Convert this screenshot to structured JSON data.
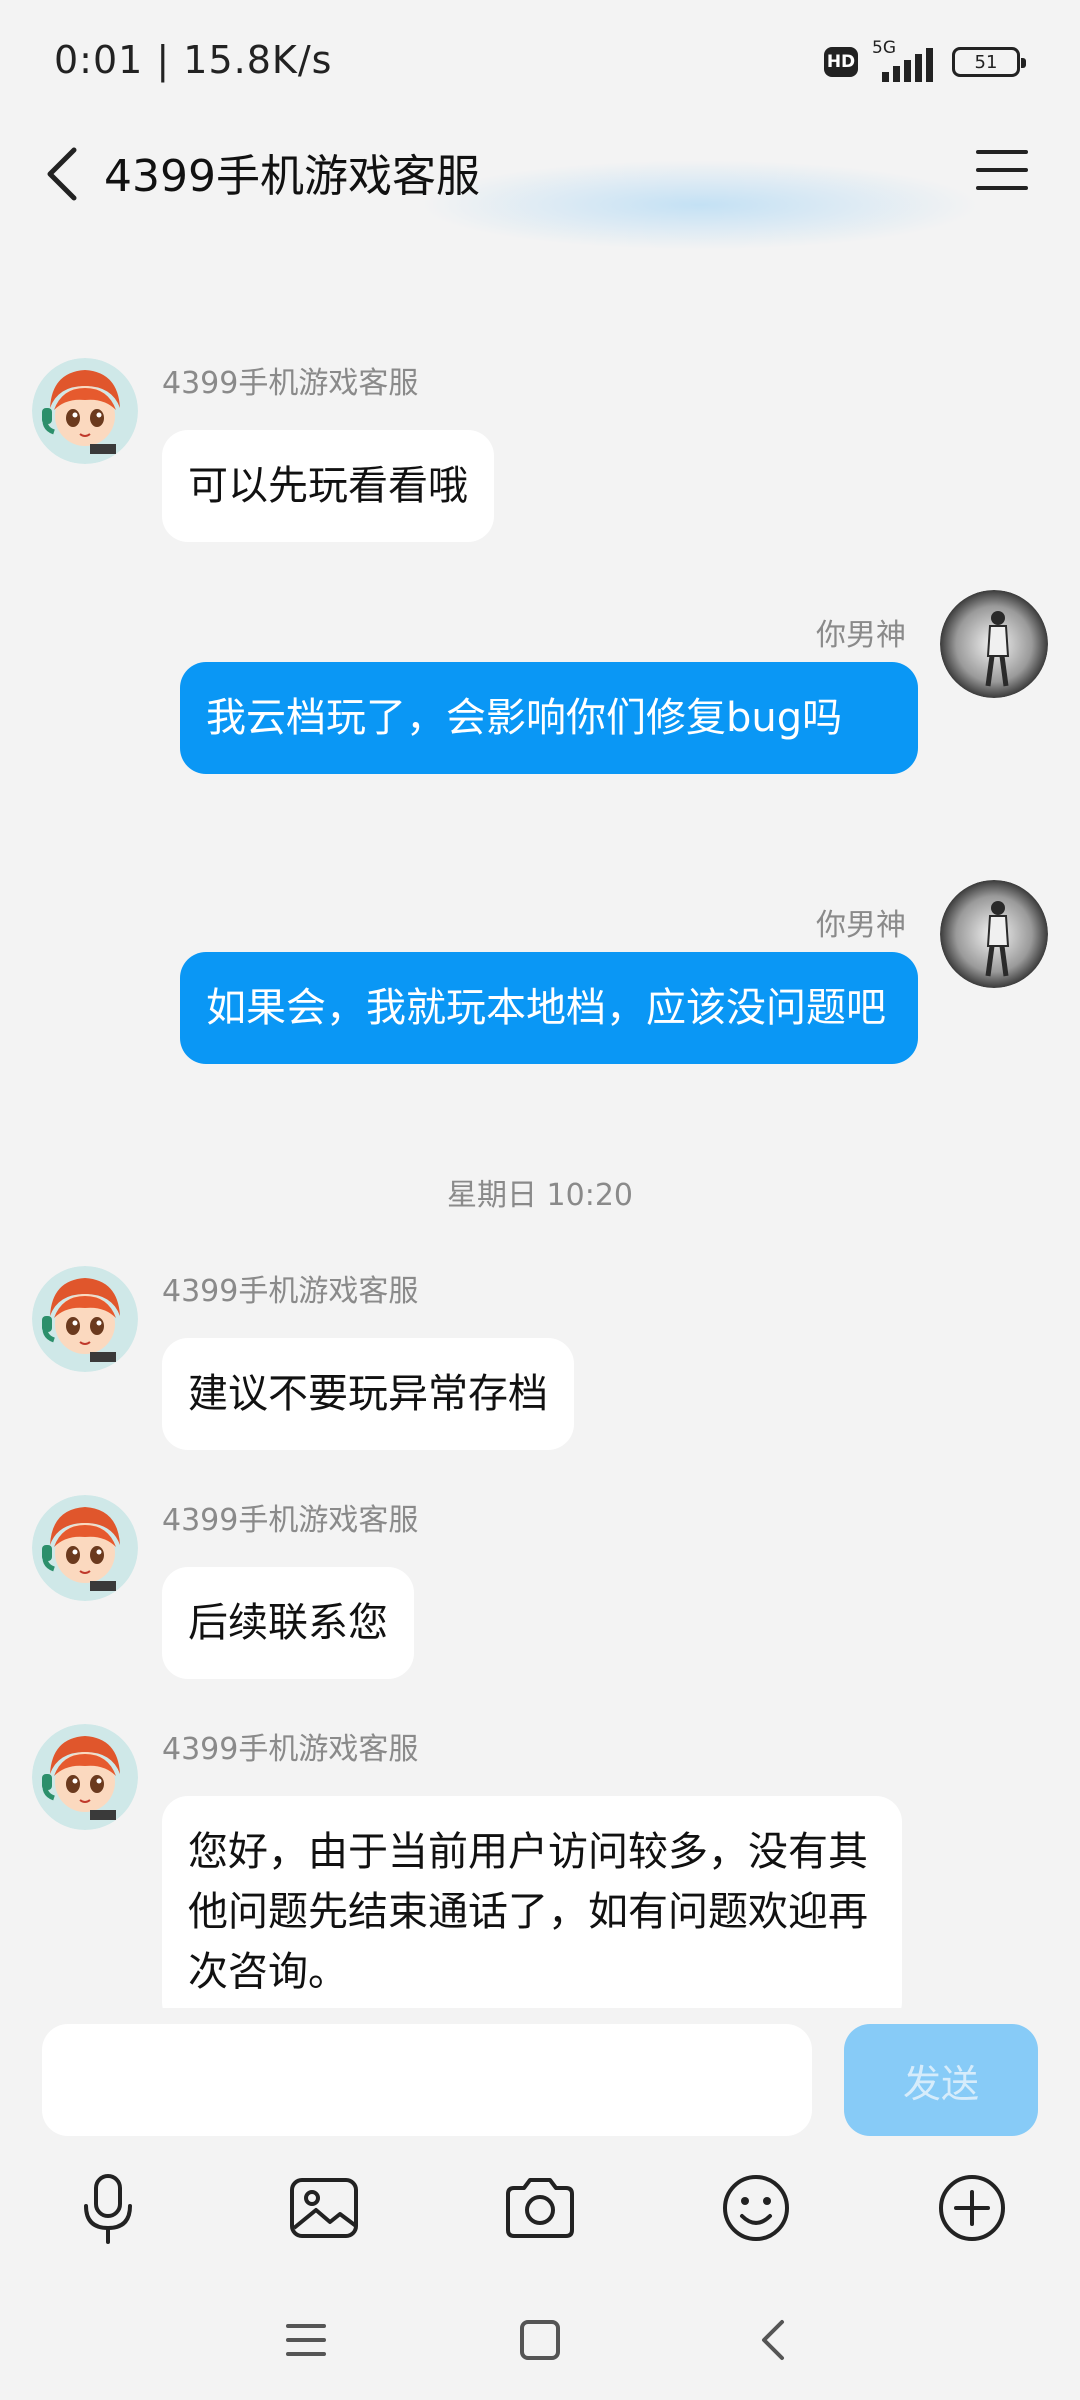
{
  "status_bar": {
    "time_speed": "0:01 | 15.8K/s",
    "hd": "HD",
    "network": "5G",
    "battery": "51"
  },
  "header": {
    "title": "4399手机游戏客服"
  },
  "messages": [
    {
      "sender": "4399手机游戏客服",
      "text": "可以先玩看看哦"
    },
    {
      "sender": "你男神",
      "text": "我云档玩了，会影响你们修复bug吗"
    },
    {
      "sender": "你男神",
      "text": "如果会，我就玩本地档，应该没问题吧"
    },
    {
      "timestamp": "星期日 10:20"
    },
    {
      "sender": "4399手机游戏客服",
      "text": "建议不要玩异常存档"
    },
    {
      "sender": "4399手机游戏客服",
      "text": "后续联系您"
    },
    {
      "sender": "4399手机游戏客服",
      "text": "您好，由于当前用户访问较多，没有其他问题先结束通话了，如有问题欢迎再次咨询。"
    }
  ],
  "input": {
    "value": "",
    "send_label": "发送"
  },
  "toolbar": [
    "microphone-icon",
    "image-icon",
    "camera-icon",
    "emoji-icon",
    "plus-icon"
  ],
  "colors": {
    "accent_blue": "#0a97f5",
    "send_disabled": "#87cbf7",
    "background": "#f3f3f3"
  }
}
